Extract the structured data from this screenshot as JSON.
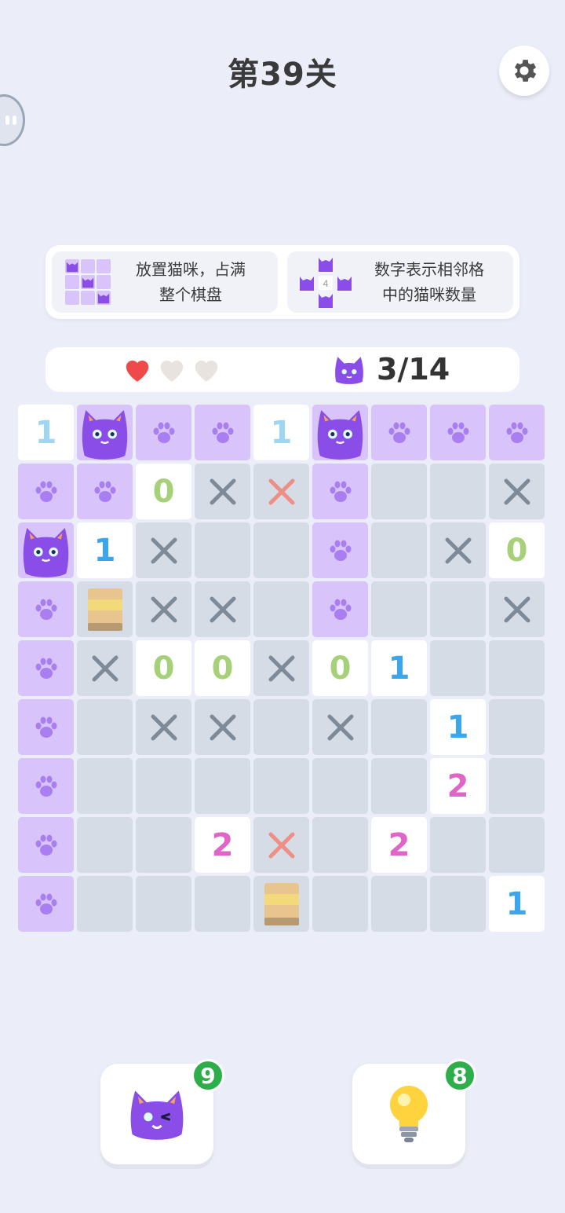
{
  "level": {
    "title": "第39关"
  },
  "rules": [
    {
      "text": "放置猫咪，占满\n整个棋盘"
    },
    {
      "text": "数字表示相邻格\n中的猫咪数量",
      "example_number": "4"
    }
  ],
  "status": {
    "lives_total": 3,
    "lives_remaining": 1,
    "cat_count": "3/14"
  },
  "board": {
    "size": 9,
    "rows": [
      [
        "1",
        "C",
        "P",
        "P",
        "1",
        "C",
        "P",
        "P",
        "P"
      ],
      [
        "P",
        "P",
        "0",
        "X",
        "R",
        "P",
        ".",
        ".",
        "X"
      ],
      [
        "C",
        "1",
        "X",
        ".",
        ".",
        "P",
        ".",
        "X",
        "0"
      ],
      [
        "P",
        "B",
        "X",
        "X",
        ".",
        "P",
        ".",
        ".",
        "X"
      ],
      [
        "P",
        "X",
        "0",
        "0",
        "X",
        "0",
        "1",
        ".",
        "."
      ],
      [
        "P",
        ".",
        "X",
        "X",
        ".",
        "X",
        ".",
        "1",
        "."
      ],
      [
        "P",
        ".",
        ".",
        ".",
        ".",
        ".",
        ".",
        "2",
        "."
      ],
      [
        "P",
        ".",
        ".",
        "2",
        "R",
        ".",
        "2",
        ".",
        "."
      ],
      [
        "P",
        ".",
        ".",
        ".",
        "B",
        ".",
        ".",
        ".",
        "1"
      ]
    ],
    "legend": {
      "C": "cat",
      "P": "paw-marked cell",
      "X": "gray cross",
      "R": "red cross",
      "B": "box",
      ".": "empty"
    },
    "number_colors": {
      "0": "#a6d178",
      "1": "#3ba6ee",
      "2": "#e065c6",
      "1_light": "#9fd7f2"
    }
  },
  "tools": {
    "cat_hint": {
      "count": "9",
      "icon": "winking-cat-icon"
    },
    "lightbulb_hint": {
      "count": "8",
      "icon": "lightbulb-icon"
    }
  },
  "colors": {
    "background": "#ebeef8",
    "paw_cell": "#d8c4fb",
    "empty_cell": "#d5dce6",
    "cat": "#8a4de8",
    "badge": "#2dae4a",
    "heart_full": "#ef4a4a",
    "heart_empty": "#e8e3de"
  }
}
